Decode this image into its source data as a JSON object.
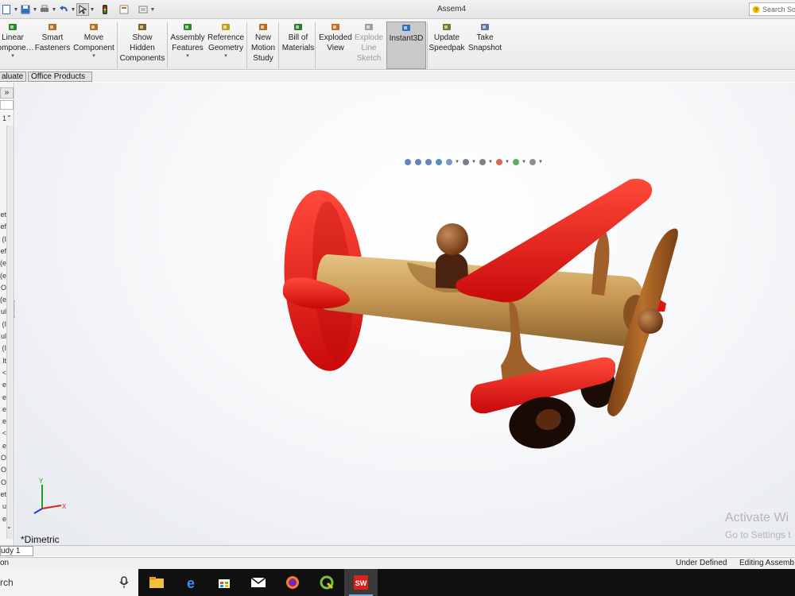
{
  "window": {
    "document_title": "Assem4",
    "search_placeholder": "Search Sol"
  },
  "quick_access": [
    {
      "name": "new-icon"
    },
    {
      "name": "save-icon"
    },
    {
      "name": "print-icon"
    },
    {
      "name": "undo-icon"
    },
    {
      "name": "select-icon"
    },
    {
      "name": "rebuild-icon"
    },
    {
      "name": "file-properties-icon"
    },
    {
      "name": "options-icon"
    }
  ],
  "command_manager": {
    "items": [
      {
        "id": "linear-component-pattern",
        "label": "Linear\nCompone…",
        "icon": "linear-pattern-icon",
        "has_caret": true,
        "state": "normal"
      },
      {
        "id": "smart-fasteners",
        "label": "Smart\nFasteners",
        "icon": "smart-fasteners-icon",
        "has_caret": false,
        "state": "normal"
      },
      {
        "id": "move-component",
        "label": "Move\nComponent",
        "icon": "move-component-icon",
        "has_caret": true,
        "state": "normal"
      },
      {
        "id": "show-hidden-components",
        "label": "Show\nHidden\nComponents",
        "icon": "show-hidden-icon",
        "has_caret": false,
        "state": "normal"
      },
      {
        "id": "assembly-features",
        "label": "Assembly\nFeatures",
        "icon": "assembly-features-icon",
        "has_caret": true,
        "state": "normal"
      },
      {
        "id": "reference-geometry",
        "label": "Reference\nGeometry",
        "icon": "reference-geometry-icon",
        "has_caret": true,
        "state": "normal"
      },
      {
        "id": "new-motion-study",
        "label": "New\nMotion\nStudy",
        "icon": "motion-study-icon",
        "has_caret": false,
        "state": "normal"
      },
      {
        "id": "bill-of-materials",
        "label": "Bill of\nMaterials",
        "icon": "bom-icon",
        "has_caret": false,
        "state": "normal"
      },
      {
        "id": "exploded-view",
        "label": "Exploded\nView",
        "icon": "exploded-view-icon",
        "has_caret": false,
        "state": "normal"
      },
      {
        "id": "explode-line-sketch",
        "label": "Explode\nLine\nSketch",
        "icon": "explode-line-icon",
        "has_caret": false,
        "state": "disabled"
      },
      {
        "id": "instant3d",
        "label": "Instant3D",
        "icon": "instant3d-icon",
        "has_caret": false,
        "state": "active"
      },
      {
        "id": "update-speedpak",
        "label": "Update\nSpeedpak",
        "icon": "speedpak-icon",
        "has_caret": false,
        "state": "normal"
      },
      {
        "id": "take-snapshot",
        "label": "Take\nSnapshot",
        "icon": "snapshot-icon",
        "has_caret": false,
        "state": "normal"
      }
    ]
  },
  "tabs": [
    "aluate",
    "Office Products"
  ],
  "left_panel": {
    "expand_label": "»",
    "item_number": "1",
    "tree_fragments": [
      "et",
      "ef",
      "(I",
      "ef",
      "(e",
      "(e",
      "O",
      "(e",
      "ul",
      "(I",
      "ul",
      "(I",
      "lt",
      "<",
      "e",
      "e",
      "e",
      "e",
      "<",
      "e",
      "O",
      "O",
      "O",
      "et",
      "u",
      "e"
    ]
  },
  "viewport": {
    "view_label": "*Dimetric",
    "triad": {
      "x": "X",
      "y": "Y"
    },
    "headsup_icons": [
      "zoom-fit-icon",
      "zoom-area-icon",
      "previous-view-icon",
      "section-view-icon",
      "view-orientation-icon",
      "display-style-icon",
      "hide-show-icon",
      "edit-appearance-icon",
      "apply-scene-icon",
      "view-settings-icon"
    ],
    "watermark": {
      "line1": "Activate Wi",
      "line2": "Go to Settings t"
    },
    "colors": {
      "wing": "#e01414",
      "fuselage": "#c89a55",
      "wood_dark": "#8a4a1e",
      "tire": "#1a0a05"
    }
  },
  "bottom_tab": "udy 1",
  "status": {
    "left": "on",
    "state": "Under Defined",
    "mode": "Editing Assemb"
  },
  "taskbar": {
    "search_text": "rch",
    "apps": [
      {
        "name": "file-explorer-icon",
        "active": false
      },
      {
        "name": "edge-icon",
        "active": false
      },
      {
        "name": "store-icon",
        "active": false
      },
      {
        "name": "mail-icon",
        "active": false
      },
      {
        "name": "firefox-icon",
        "active": false
      },
      {
        "name": "qgis-icon",
        "active": false
      },
      {
        "name": "solidworks-icon",
        "active": true
      }
    ]
  }
}
